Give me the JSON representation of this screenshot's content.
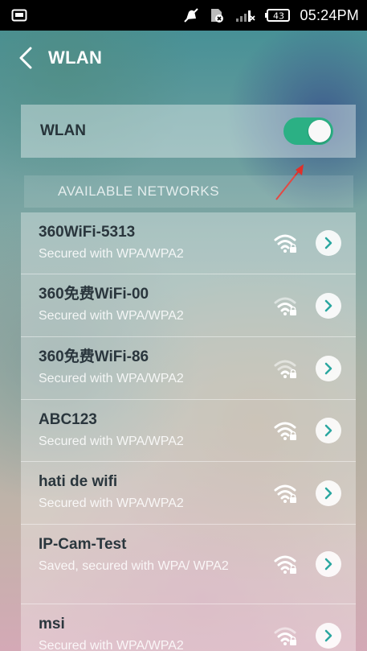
{
  "status_bar": {
    "time": "05:24PM",
    "battery_level": "43",
    "icons": [
      "image-icon",
      "notifications-off-icon",
      "sim-icon",
      "signal-icon",
      "battery-icon"
    ]
  },
  "header": {
    "title": "WLAN",
    "back_icon": "back-chevron-icon"
  },
  "wlan_toggle": {
    "label": "WLAN",
    "enabled": true,
    "accent_color": "#2bb084"
  },
  "available_networks": {
    "header": "AVAILABLE NETWORKS",
    "networks": [
      {
        "name": "360WiFi-5313",
        "status": "Secured with WPA/WPA2",
        "signal": "strong"
      },
      {
        "name": "360免费WiFi-00",
        "status": "Secured with WPA/WPA2",
        "signal": "medium"
      },
      {
        "name": "360免费WiFi-86",
        "status": "Secured with WPA/WPA2",
        "signal": "weak"
      },
      {
        "name": "ABC123",
        "status": "Secured with WPA/WPA2",
        "signal": "strong"
      },
      {
        "name": "hati de wifi",
        "status": "Secured with WPA/WPA2",
        "signal": "strong"
      },
      {
        "name": "IP-Cam-Test",
        "status": "Saved, secured with WPA/ WPA2",
        "signal": "strong"
      },
      {
        "name": "msi",
        "status": "Secured with WPA/WPA2",
        "signal": "medium"
      }
    ]
  },
  "annotation": {
    "color": "#e0302a"
  }
}
